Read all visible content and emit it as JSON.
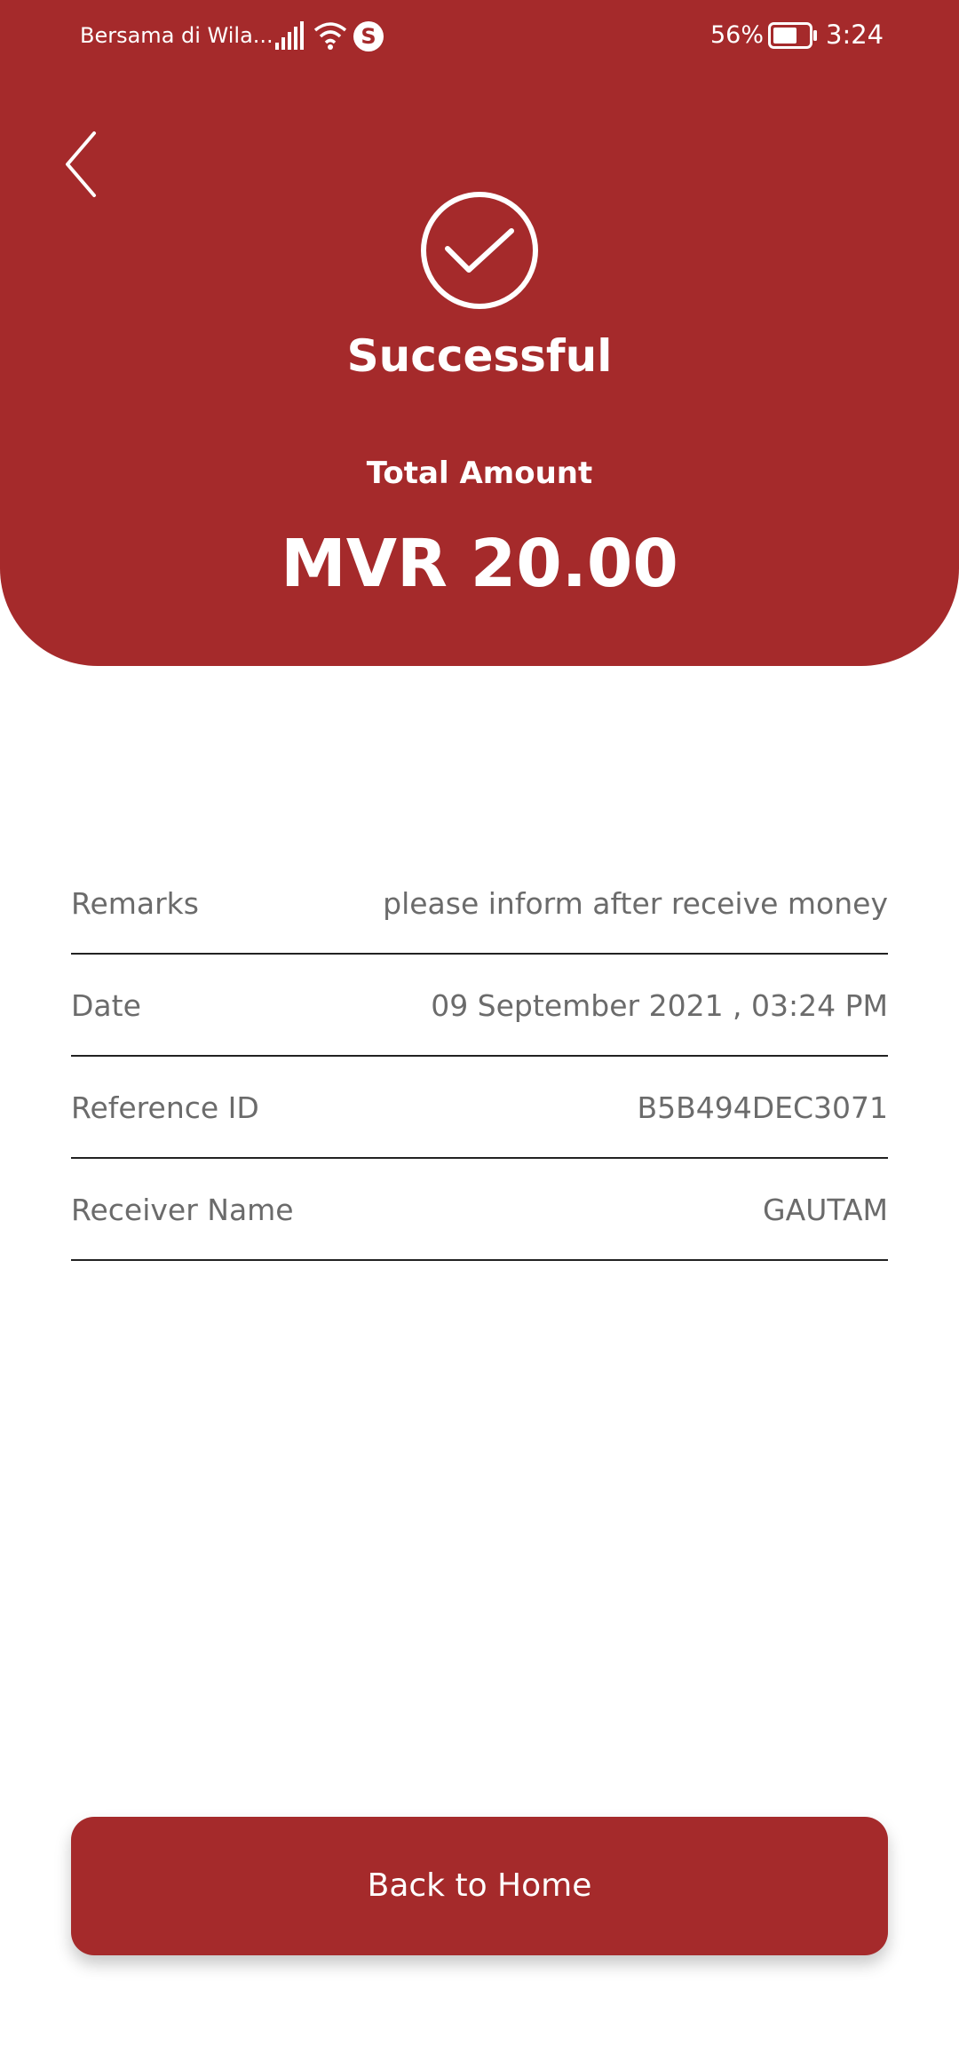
{
  "status_bar": {
    "carrier": "Bersama di Wila...",
    "battery_percent": "56%",
    "time": "3:24"
  },
  "icons": {
    "back": "chevron-left-icon",
    "success": "check-circle-icon",
    "signal": "signal-icon",
    "wifi": "wifi-icon",
    "skype": "skype-icon",
    "skype_glyph": "S",
    "battery": "battery-icon"
  },
  "header": {
    "title": "Successful",
    "amount_label": "Total Amount",
    "amount_value": "MVR 20.00"
  },
  "details": {
    "rows": [
      {
        "label": "Remarks",
        "value": "please inform after receive money"
      },
      {
        "label": "Date",
        "value": "09 September 2021 , 03:24 PM"
      },
      {
        "label": "Reference ID",
        "value": "B5B494DEC3071"
      },
      {
        "label": "Receiver Name",
        "value": "GAUTAM"
      }
    ]
  },
  "actions": {
    "home_label": "Back to Home"
  },
  "colors": {
    "brand": "#a52a2b",
    "text_secondary": "#6b6b6b"
  }
}
